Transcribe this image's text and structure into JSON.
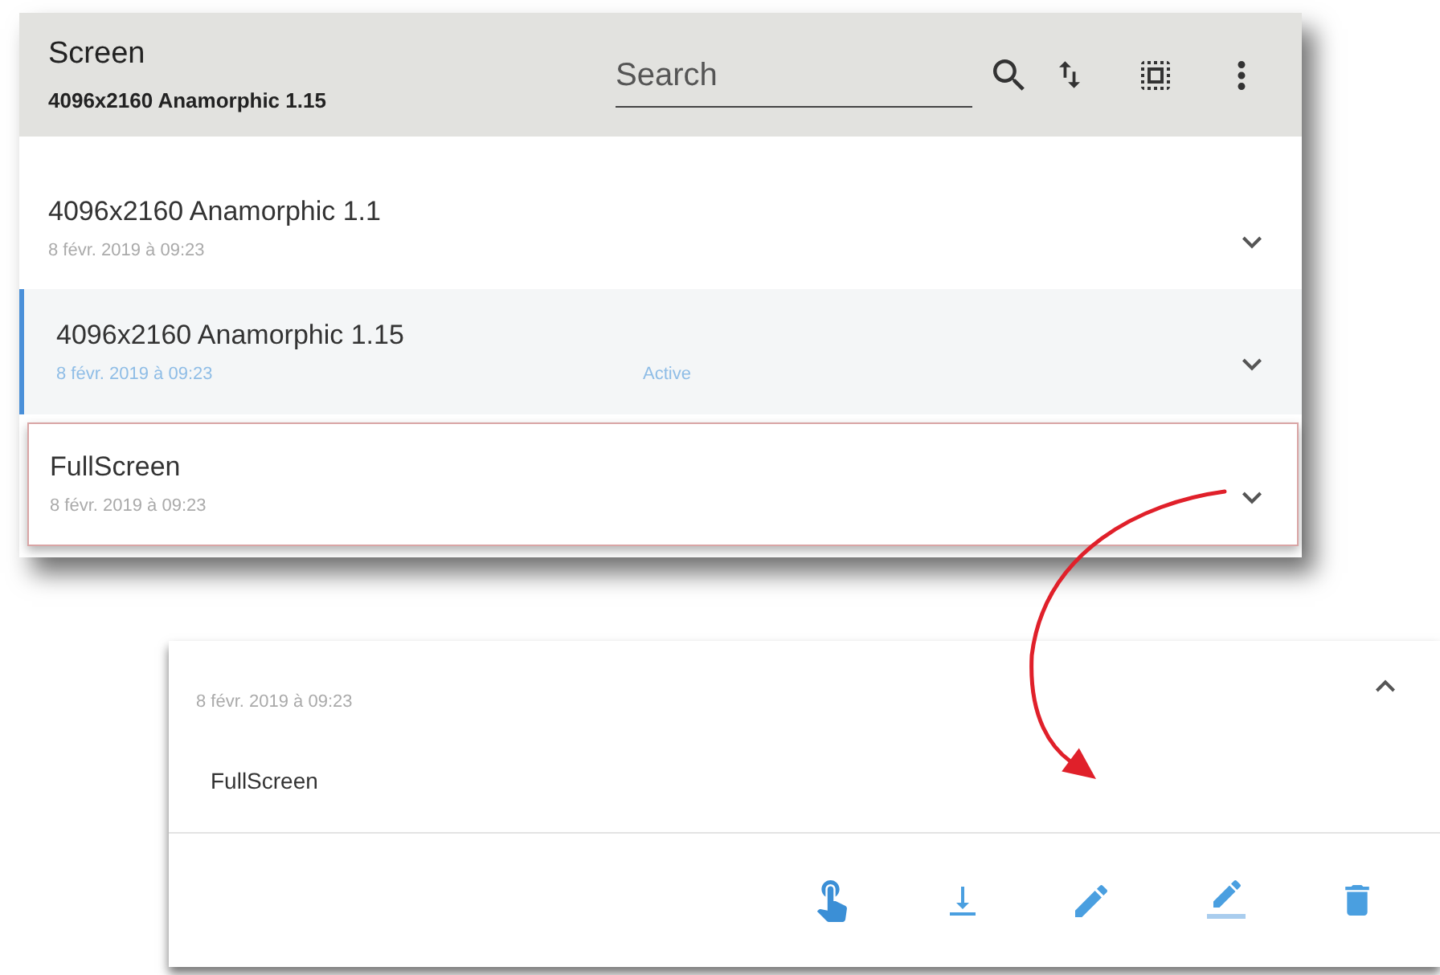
{
  "header": {
    "title": "Screen",
    "subtitle": "4096x2160 Anamorphic 1.15"
  },
  "search": {
    "placeholder": "Search"
  },
  "presets": [
    {
      "name": "4096x2160 Anamorphic 1.1",
      "date": "8 févr. 2019 à 09:23",
      "selected": false,
      "highlighted": false,
      "expanded": false
    },
    {
      "name": "4096x2160 Anamorphic 1.15",
      "date": "8 févr. 2019 à 09:23",
      "status": "Active",
      "selected": true,
      "highlighted": false,
      "expanded": false
    },
    {
      "name": "FullScreen",
      "date": "8 févr. 2019 à 09:23",
      "selected": false,
      "highlighted": true,
      "expanded": false
    }
  ],
  "detail": {
    "date": "8 févr. 2019 à 09:23",
    "name": "FullScreen",
    "expanded": true
  }
}
